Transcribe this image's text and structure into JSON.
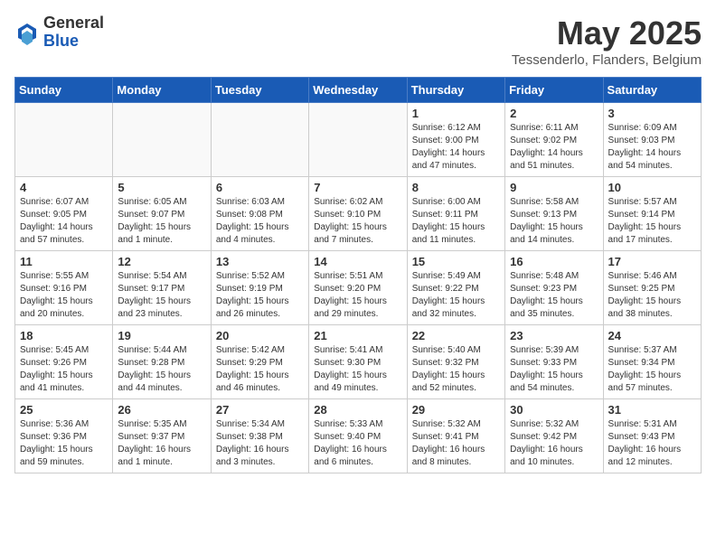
{
  "header": {
    "logo_general": "General",
    "logo_blue": "Blue",
    "month_year": "May 2025",
    "location": "Tessenderlo, Flanders, Belgium"
  },
  "days_of_week": [
    "Sunday",
    "Monday",
    "Tuesday",
    "Wednesday",
    "Thursday",
    "Friday",
    "Saturday"
  ],
  "weeks": [
    [
      {
        "day": "",
        "info": ""
      },
      {
        "day": "",
        "info": ""
      },
      {
        "day": "",
        "info": ""
      },
      {
        "day": "",
        "info": ""
      },
      {
        "day": "1",
        "info": "Sunrise: 6:12 AM\nSunset: 9:00 PM\nDaylight: 14 hours\nand 47 minutes."
      },
      {
        "day": "2",
        "info": "Sunrise: 6:11 AM\nSunset: 9:02 PM\nDaylight: 14 hours\nand 51 minutes."
      },
      {
        "day": "3",
        "info": "Sunrise: 6:09 AM\nSunset: 9:03 PM\nDaylight: 14 hours\nand 54 minutes."
      }
    ],
    [
      {
        "day": "4",
        "info": "Sunrise: 6:07 AM\nSunset: 9:05 PM\nDaylight: 14 hours\nand 57 minutes."
      },
      {
        "day": "5",
        "info": "Sunrise: 6:05 AM\nSunset: 9:07 PM\nDaylight: 15 hours\nand 1 minute."
      },
      {
        "day": "6",
        "info": "Sunrise: 6:03 AM\nSunset: 9:08 PM\nDaylight: 15 hours\nand 4 minutes."
      },
      {
        "day": "7",
        "info": "Sunrise: 6:02 AM\nSunset: 9:10 PM\nDaylight: 15 hours\nand 7 minutes."
      },
      {
        "day": "8",
        "info": "Sunrise: 6:00 AM\nSunset: 9:11 PM\nDaylight: 15 hours\nand 11 minutes."
      },
      {
        "day": "9",
        "info": "Sunrise: 5:58 AM\nSunset: 9:13 PM\nDaylight: 15 hours\nand 14 minutes."
      },
      {
        "day": "10",
        "info": "Sunrise: 5:57 AM\nSunset: 9:14 PM\nDaylight: 15 hours\nand 17 minutes."
      }
    ],
    [
      {
        "day": "11",
        "info": "Sunrise: 5:55 AM\nSunset: 9:16 PM\nDaylight: 15 hours\nand 20 minutes."
      },
      {
        "day": "12",
        "info": "Sunrise: 5:54 AM\nSunset: 9:17 PM\nDaylight: 15 hours\nand 23 minutes."
      },
      {
        "day": "13",
        "info": "Sunrise: 5:52 AM\nSunset: 9:19 PM\nDaylight: 15 hours\nand 26 minutes."
      },
      {
        "day": "14",
        "info": "Sunrise: 5:51 AM\nSunset: 9:20 PM\nDaylight: 15 hours\nand 29 minutes."
      },
      {
        "day": "15",
        "info": "Sunrise: 5:49 AM\nSunset: 9:22 PM\nDaylight: 15 hours\nand 32 minutes."
      },
      {
        "day": "16",
        "info": "Sunrise: 5:48 AM\nSunset: 9:23 PM\nDaylight: 15 hours\nand 35 minutes."
      },
      {
        "day": "17",
        "info": "Sunrise: 5:46 AM\nSunset: 9:25 PM\nDaylight: 15 hours\nand 38 minutes."
      }
    ],
    [
      {
        "day": "18",
        "info": "Sunrise: 5:45 AM\nSunset: 9:26 PM\nDaylight: 15 hours\nand 41 minutes."
      },
      {
        "day": "19",
        "info": "Sunrise: 5:44 AM\nSunset: 9:28 PM\nDaylight: 15 hours\nand 44 minutes."
      },
      {
        "day": "20",
        "info": "Sunrise: 5:42 AM\nSunset: 9:29 PM\nDaylight: 15 hours\nand 46 minutes."
      },
      {
        "day": "21",
        "info": "Sunrise: 5:41 AM\nSunset: 9:30 PM\nDaylight: 15 hours\nand 49 minutes."
      },
      {
        "day": "22",
        "info": "Sunrise: 5:40 AM\nSunset: 9:32 PM\nDaylight: 15 hours\nand 52 minutes."
      },
      {
        "day": "23",
        "info": "Sunrise: 5:39 AM\nSunset: 9:33 PM\nDaylight: 15 hours\nand 54 minutes."
      },
      {
        "day": "24",
        "info": "Sunrise: 5:37 AM\nSunset: 9:34 PM\nDaylight: 15 hours\nand 57 minutes."
      }
    ],
    [
      {
        "day": "25",
        "info": "Sunrise: 5:36 AM\nSunset: 9:36 PM\nDaylight: 15 hours\nand 59 minutes."
      },
      {
        "day": "26",
        "info": "Sunrise: 5:35 AM\nSunset: 9:37 PM\nDaylight: 16 hours\nand 1 minute."
      },
      {
        "day": "27",
        "info": "Sunrise: 5:34 AM\nSunset: 9:38 PM\nDaylight: 16 hours\nand 3 minutes."
      },
      {
        "day": "28",
        "info": "Sunrise: 5:33 AM\nSunset: 9:40 PM\nDaylight: 16 hours\nand 6 minutes."
      },
      {
        "day": "29",
        "info": "Sunrise: 5:32 AM\nSunset: 9:41 PM\nDaylight: 16 hours\nand 8 minutes."
      },
      {
        "day": "30",
        "info": "Sunrise: 5:32 AM\nSunset: 9:42 PM\nDaylight: 16 hours\nand 10 minutes."
      },
      {
        "day": "31",
        "info": "Sunrise: 5:31 AM\nSunset: 9:43 PM\nDaylight: 16 hours\nand 12 minutes."
      }
    ]
  ]
}
